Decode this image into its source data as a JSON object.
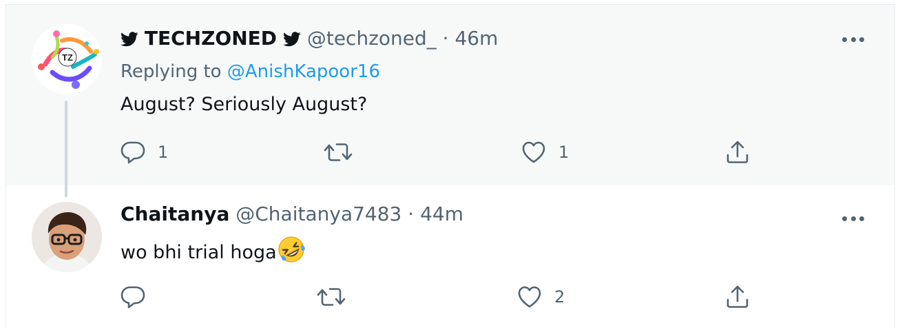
{
  "tweets": [
    {
      "display_name": "TECHZONED",
      "handle": "@techzoned_",
      "separator": "·",
      "time": "46m",
      "replying_prefix": "Replying to",
      "replying_mention": "@AnishKapoor16",
      "text": "August? Seriously August?",
      "avatar_initials": "TZ",
      "actions": {
        "reply": "1",
        "retweet": "",
        "like": "1"
      }
    },
    {
      "display_name": "Chaitanya",
      "handle": "@Chaitanya7483",
      "separator": "·",
      "time": "44m",
      "text": "wo bhi trial hoga",
      "emoji": "rolling-on-the-floor-laughing",
      "actions": {
        "reply": "",
        "retweet": "",
        "like": "2"
      }
    }
  ],
  "colors": {
    "name": "#0f1419",
    "secondary": "#536471",
    "mention": "#1d9bf0",
    "highlight_background": "#f7f9f9"
  },
  "icons": [
    "twitter-bird-icon",
    "more-icon",
    "reply-icon",
    "retweet-icon",
    "like-icon",
    "share-icon"
  ]
}
